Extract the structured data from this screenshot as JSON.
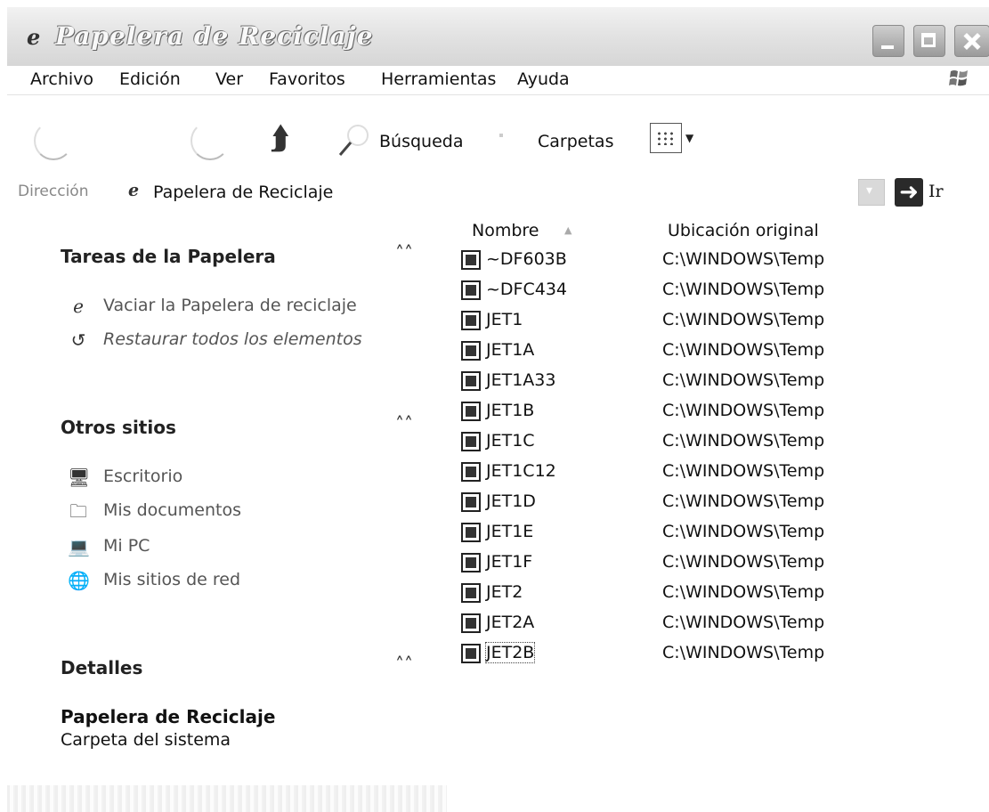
{
  "window": {
    "title": "Papelera de Reciclaje",
    "title_icon": "recycle-bin-icon"
  },
  "menu": {
    "items": [
      {
        "label": "Archivo"
      },
      {
        "label": "Edición"
      },
      {
        "label": "Ver"
      },
      {
        "label": "Favoritos"
      },
      {
        "label": "Herramientas"
      },
      {
        "label": "Ayuda"
      }
    ]
  },
  "toolbar": {
    "search_label": "Búsqueda",
    "folders_label": "Carpetas"
  },
  "address": {
    "label": "Dirección",
    "value": "Papelera de Reciclaje",
    "go_label": "Ir"
  },
  "taskpane": {
    "recycle_tasks": {
      "header": "Tareas de la Papelera",
      "items": [
        {
          "label": "Vaciar la Papelera de reciclaje",
          "icon": "recycle-bin-icon"
        },
        {
          "label": "Restaurar todos los elementos",
          "icon": "restore-icon"
        }
      ]
    },
    "other_places": {
      "header": "Otros sitios",
      "items": [
        {
          "label": "Escritorio",
          "icon": "desktop-icon"
        },
        {
          "label": "Mis documentos",
          "icon": "documents-folder-icon"
        },
        {
          "label": "Mi PC",
          "icon": "computer-icon"
        },
        {
          "label": "Mis sitios de red",
          "icon": "network-places-icon"
        }
      ]
    },
    "details": {
      "header": "Detalles",
      "title": "Papelera de Reciclaje",
      "subtitle": "Carpeta del sistema"
    }
  },
  "filelist": {
    "columns": {
      "name": "Nombre",
      "location": "Ubicación original"
    },
    "rows": [
      {
        "name": "~DF603B",
        "location": "C:\\WINDOWS\\Temp"
      },
      {
        "name": "~DFC434",
        "location": "C:\\WINDOWS\\Temp"
      },
      {
        "name": "JET1",
        "location": "C:\\WINDOWS\\Temp"
      },
      {
        "name": "JET1A",
        "location": "C:\\WINDOWS\\Temp"
      },
      {
        "name": "JET1A33",
        "location": "C:\\WINDOWS\\Temp"
      },
      {
        "name": "JET1B",
        "location": "C:\\WINDOWS\\Temp"
      },
      {
        "name": "JET1C",
        "location": "C:\\WINDOWS\\Temp"
      },
      {
        "name": "JET1C12",
        "location": "C:\\WINDOWS\\Temp"
      },
      {
        "name": "JET1D",
        "location": "C:\\WINDOWS\\Temp"
      },
      {
        "name": "JET1E",
        "location": "C:\\WINDOWS\\Temp"
      },
      {
        "name": "JET1F",
        "location": "C:\\WINDOWS\\Temp"
      },
      {
        "name": "JET2",
        "location": "C:\\WINDOWS\\Temp"
      },
      {
        "name": "JET2A",
        "location": "C:\\WINDOWS\\Temp"
      },
      {
        "name": "JET2B",
        "location": "C:\\WINDOWS\\Temp"
      }
    ]
  }
}
